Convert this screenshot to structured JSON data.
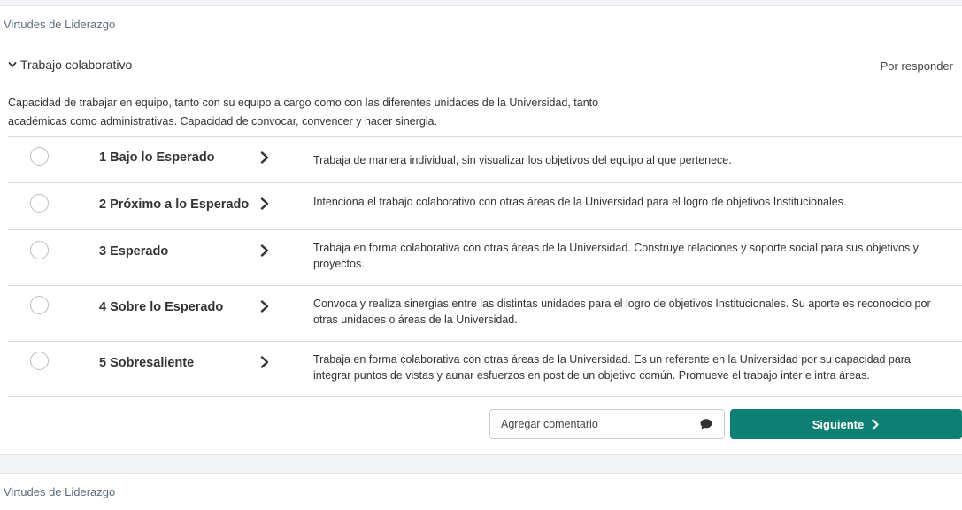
{
  "section_title": "Virtudes de Liderazgo",
  "competency": {
    "title": "Trabajo colaborativo",
    "status": "Por responder",
    "description": "Capacidad de trabajar en equipo, tanto con su equipo a cargo como con las diferentes unidades de la Universidad, tanto académicas como administrativas. Capacidad de convocar, convencer y hacer sinergia."
  },
  "options": [
    {
      "label": "1 Bajo lo Esperado",
      "description": "Trabaja de manera individual, sin visualizar los objetivos del equipo al que pertenece."
    },
    {
      "label": "2 Próximo a lo Esperado",
      "description": "Intenciona el trabajo colaborativo con otras áreas de la Universidad para el logro de objetivos Institucionales."
    },
    {
      "label": "3 Esperado",
      "description": "Trabaja en forma colaborativa con otras áreas de la Universidad. Construye relaciones y soporte social para sus objetivos y proyectos."
    },
    {
      "label": "4 Sobre lo Esperado",
      "description": "Convoca y realiza sinergias entre las distintas unidades para el logro de objetivos Institucionales. Su aporte es reconocido por otras unidades o áreas de la Universidad."
    },
    {
      "label": "5 Sobresaliente",
      "description": "Trabaja en forma colaborativa con otras áreas de la Universidad. Es un referente en la Universidad por su capacidad para integrar puntos de vistas y aunar esfuerzos en post de un objetivo común. Promueve el trabajo inter e intra áreas."
    }
  ],
  "comment": {
    "placeholder": "Agregar comentario",
    "value": "",
    "icon": "comment-bubble-icon"
  },
  "next_button": {
    "label": "Siguiente",
    "icon": "chevron-right-icon"
  },
  "next_section_title": "Virtudes de Liderazgo",
  "colors": {
    "accent": "#0e7f73",
    "section_title": "#5c6b80",
    "divider": "#d8dbe0"
  }
}
